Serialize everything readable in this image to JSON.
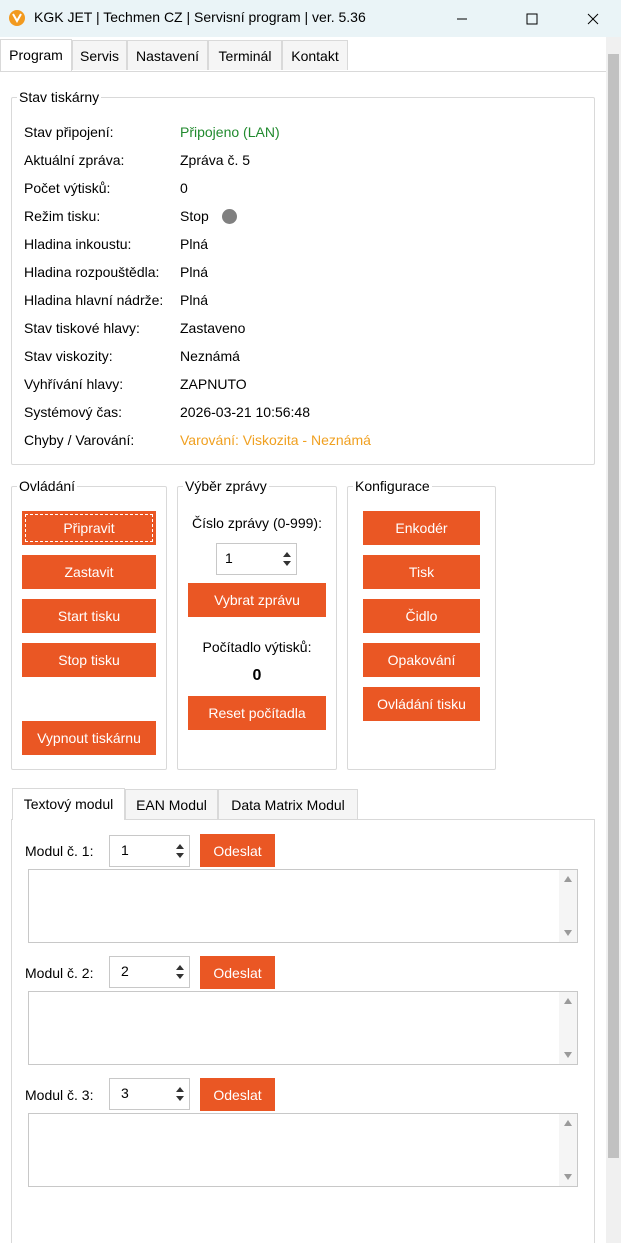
{
  "window": {
    "title": "KGK JET | Techmen CZ | Servisní program | ver. 5.36"
  },
  "main_tabs": [
    "Program",
    "Servis",
    "Nastavení",
    "Terminál",
    "Kontakt"
  ],
  "status_group": {
    "title": "Stav tiskárny",
    "rows": [
      {
        "label": "Stav připojení:",
        "value": "Připojeno (LAN)"
      },
      {
        "label": "Aktuální zpráva:",
        "value": "Zpráva č. 5"
      },
      {
        "label": "Počet výtisků:",
        "value": "0"
      },
      {
        "label": "Režim tisku:",
        "value": "Stop"
      },
      {
        "label": "Hladina inkoustu:",
        "value": "Plná"
      },
      {
        "label": "Hladina rozpouštědla:",
        "value": "Plná"
      },
      {
        "label": "Hladina hlavní nádrže:",
        "value": "Plná"
      },
      {
        "label": "Stav tiskové hlavy:",
        "value": "Zastaveno"
      },
      {
        "label": "Stav viskozity:",
        "value": "Neznámá"
      },
      {
        "label": "Vyhřívání hlavy:",
        "value": "ZAPNUTO"
      },
      {
        "label": "Systémový čas:",
        "value": "2026-03-21 10:56:48"
      },
      {
        "label": "Chyby / Varování:",
        "value": "Varování: Viskozita - Neznámá"
      }
    ]
  },
  "control_group": {
    "title": "Ovládání",
    "buttons": [
      "Připravit",
      "Zastavit",
      "Start tisku",
      "Stop tisku",
      "Vypnout tiskárnu"
    ]
  },
  "message_group": {
    "title": "Výběr zprávy",
    "number_label": "Číslo zprávy (0-999):",
    "number_value": "1",
    "select_button": "Vybrat zprávu",
    "counter_label": "Počítadlo výtisků:",
    "counter_value": "0",
    "reset_button": "Reset počítadla"
  },
  "config_group": {
    "title": "Konfigurace",
    "buttons": [
      "Enkodér",
      "Tisk",
      "Čidlo",
      "Opakování",
      "Ovládání tisku"
    ]
  },
  "module_tabs": [
    "Textový modul",
    "EAN Modul",
    "Data Matrix Modul"
  ],
  "modules": [
    {
      "label": "Modul č. 1:",
      "value": "1",
      "send": "Odeslat",
      "text": ""
    },
    {
      "label": "Modul č. 2:",
      "value": "2",
      "send": "Odeslat",
      "text": ""
    },
    {
      "label": "Modul č. 3:",
      "value": "3",
      "send": "Odeslat",
      "text": ""
    }
  ],
  "colors": {
    "accent": "#ea5724",
    "connected": "#218a2e",
    "warning": "#f0a020",
    "titlebar": "#eaf4f7"
  },
  "icons": {
    "app": "kgk-logo-icon",
    "minimize": "minimize-icon",
    "maximize": "maximize-icon",
    "close": "close-icon",
    "status_dot": "status-dot-icon"
  }
}
